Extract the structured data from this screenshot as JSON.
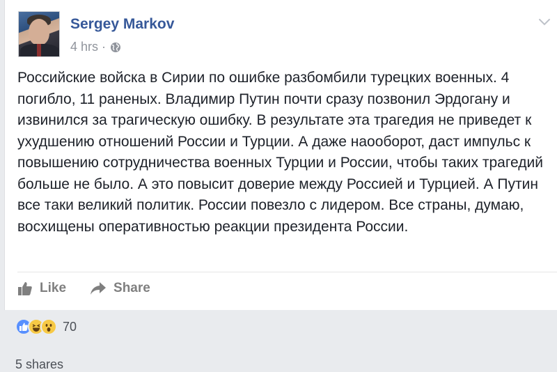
{
  "post": {
    "author": "Sergey Markov",
    "time": "4 hrs",
    "dot": "·",
    "text": "Российские войска в Сирии по ошибке разбомбили турецких военных. 4 погибло, 11 раненых. Владимир Путин почти сразу позвонил Эрдогану и извинился за трагическую ошибку. В результате эта трагедия не приведет к ухудшению отношений России и Турции. А даже наооборот, даст импульс к повышению сотрудничества военных Турции и России, чтобы таких трагедий больше не было. А это повысит доверие между Россией и Турцией. А Путин все таки великий политик. России повезло с лидером. Все страны, думаю, восхищены оперативностью реакции президента России."
  },
  "actions": {
    "like_label": "Like",
    "share_label": "Share"
  },
  "stats": {
    "reaction_count": "70",
    "shares": "5 shares"
  },
  "icons": {
    "globe": "globe-icon",
    "chevron": "chevron-down-icon",
    "like": "thumbs-up-icon",
    "share": "share-arrow-icon",
    "reactions": [
      "like-reaction-icon",
      "haha-reaction-icon",
      "wow-reaction-icon"
    ]
  },
  "colors": {
    "author_link": "#365899",
    "meta_text": "#90949c",
    "body_text": "#1d2129",
    "action_text": "#7f7f7f",
    "like_blue": "#5890ff",
    "emoji_yellow": "#f7c945"
  }
}
